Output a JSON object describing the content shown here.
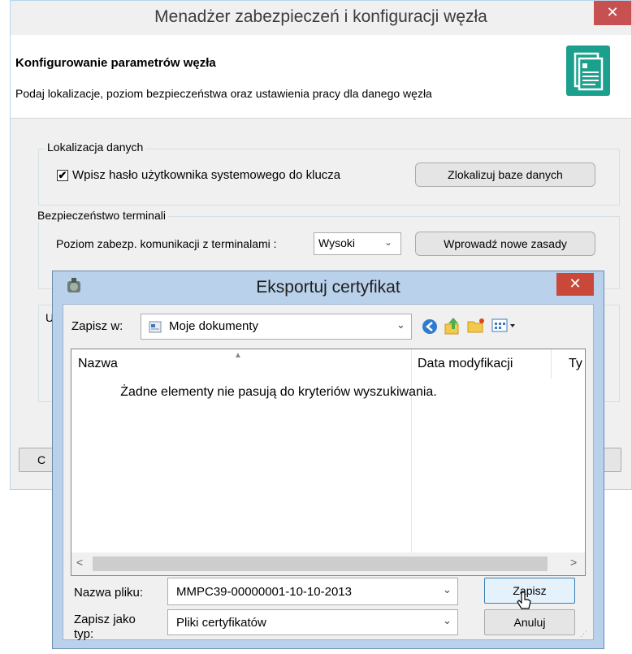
{
  "main_window": {
    "title": "Menadżer zabezpieczeń i konfiguracji węzła",
    "close_glyph": "✕",
    "header_title": "Konfigurowanie parametrów węzła",
    "header_description": "Podaj lokalizacje, poziom bezpieczeństwa oraz ustawienia pracy dla danego węzła",
    "header_icon": "document-list-icon",
    "data_location": {
      "legend": "Lokalizacja danych",
      "checkbox_label": "Wpisz hasło użytkownika systemowego do klucza",
      "checkbox_checked": true,
      "locate_button": "Zlokalizuj baze danych"
    },
    "terminal_security": {
      "legend": "Bezpieczeństwo terminali",
      "level_label": "Poziom zabezp. komunikacji z terminalami :",
      "level_value": "Wysoki",
      "new_rules_button": "Wprowadź nowe zasady"
    },
    "partial_legend": "U",
    "partial_button": "C"
  },
  "dialog": {
    "title": "Eksportuj certyfikat",
    "close_glyph": "✕",
    "save_in_label": "Zapisz w:",
    "save_in_value": "Moje dokumenty",
    "columns": [
      "Nazwa",
      "Data modyfikacji",
      "Ty"
    ],
    "empty_message": "Żadne elementy nie pasują do kryteriów wyszukiwania.",
    "scroll_left": "<",
    "scroll_right": ">",
    "filename_label": "Nazwa pliku:",
    "filename_value": "MMPC39-00000001-10-10-2013",
    "filetype_label": "Zapisz jako typ:",
    "filetype_value": "Pliki certyfikatów",
    "save_button": "Zapisz",
    "cancel_button": "Anuluj"
  },
  "colors": {
    "close_red": "#c75050",
    "dialog_frame": "#b9d1ea",
    "icon_teal": "#1aa08c"
  }
}
